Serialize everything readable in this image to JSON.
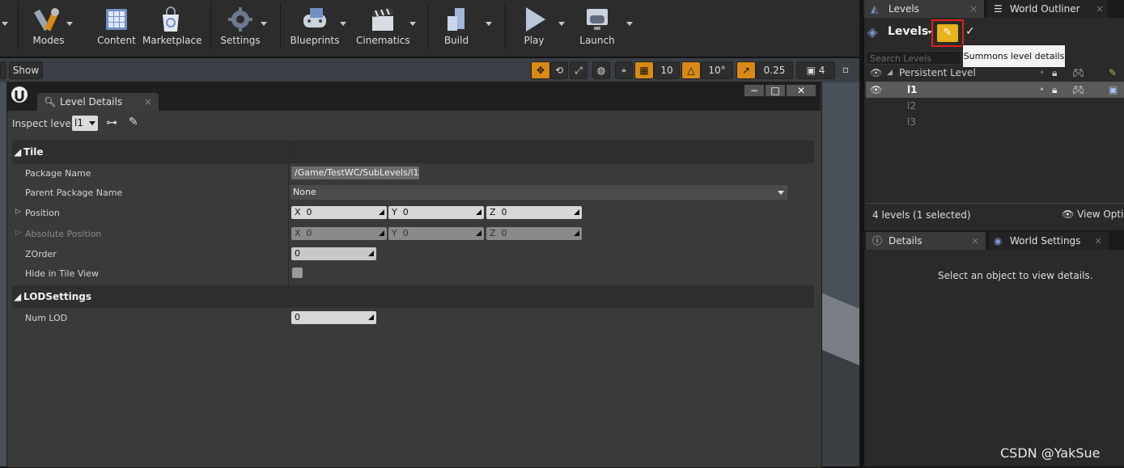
{
  "toolbar": {
    "modes": "Modes",
    "content": "Content",
    "marketplace": "Marketplace",
    "settings": "Settings",
    "blueprints": "Blueprints",
    "cinematics": "Cinematics",
    "build": "Build",
    "play": "Play",
    "launch": "Launch"
  },
  "viewport": {
    "show_label": "Show",
    "grid_snap": "10",
    "rotation_snap": "10°",
    "scale_snap": "0.25",
    "camera_speed": "4"
  },
  "level_details": {
    "tab_title": "Level Details",
    "inspect_level_label": "Inspect level:",
    "inspect_level_value": "l1",
    "tile": {
      "category": "Tile",
      "package_name_label": "Package Name",
      "package_name_value": "/Game/TestWC/SubLevels/l1",
      "parent_package_label": "Parent Package Name",
      "parent_package_value": "None",
      "position_label": "Position",
      "position_x": "0",
      "position_y": "0",
      "position_z": "0",
      "abs_position_label": "Absolute Position",
      "abs_x": "0",
      "abs_y": "0",
      "abs_z": "0",
      "zorder_label": "ZOrder",
      "zorder_value": "0",
      "hide_in_tile_view_label": "Hide in Tile View"
    },
    "lod": {
      "category": "LODSettings",
      "num_lod_label": "Num LOD",
      "num_lod_value": "0"
    },
    "axis": {
      "x": "X",
      "y": "Y",
      "z": "Z"
    }
  },
  "levels_panel": {
    "tab_levels": "Levels",
    "tab_outliner": "World Outliner",
    "header": "Levels",
    "tooltip": "Summons level details",
    "search_placeholder": "Search Levels",
    "rows": [
      {
        "name": "Persistent Level"
      },
      {
        "name": "l1"
      },
      {
        "name": "l2"
      },
      {
        "name": "l3"
      }
    ],
    "status": "4 levels (1 selected)",
    "view_options": "View Options"
  },
  "details_panel": {
    "tab_details": "Details",
    "tab_world_settings": "World Settings",
    "empty_message": "Select an object to view details."
  },
  "watermark": "CSDN @YakSue",
  "colors": {
    "accent": "#d88a14",
    "highlight": "#e01f1f",
    "selection": "#5a5a5a"
  }
}
